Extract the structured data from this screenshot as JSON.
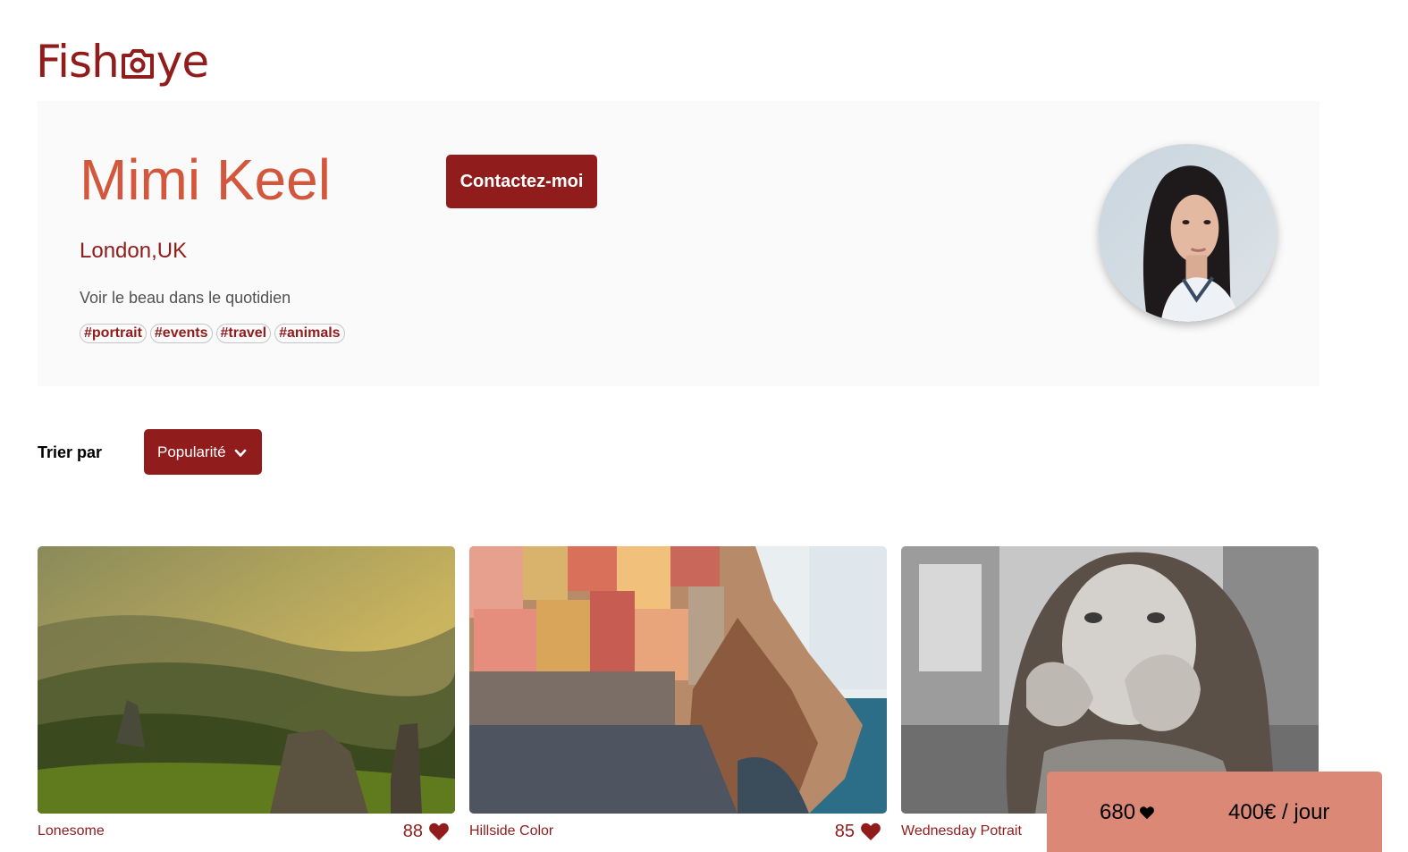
{
  "logo": {
    "text_before": "Fish",
    "text_after": "ye",
    "icon": "camera-icon"
  },
  "photographer": {
    "name": "Mimi Keel",
    "location": "London,UK",
    "tagline": "Voir le beau dans le quotidien",
    "tags": [
      "#portrait",
      "#events",
      "#travel",
      "#animals"
    ],
    "contact_label": "Contactez-moi"
  },
  "sort": {
    "label": "Trier par",
    "selected": "Popularité",
    "icon": "chevron-down-icon"
  },
  "media": [
    {
      "title": "Lonesome",
      "likes": "88"
    },
    {
      "title": "Hillside Color",
      "likes": "85"
    },
    {
      "title": "Wednesday Potrait",
      "likes": ""
    }
  ],
  "stats": {
    "total_likes": "680",
    "price": "400€ / jour",
    "icon": "heart-icon"
  },
  "colors": {
    "primary": "#901C1C",
    "secondary": "#D3573C",
    "stats_bg": "#DB8876",
    "panel_bg": "#FAFAFA"
  }
}
